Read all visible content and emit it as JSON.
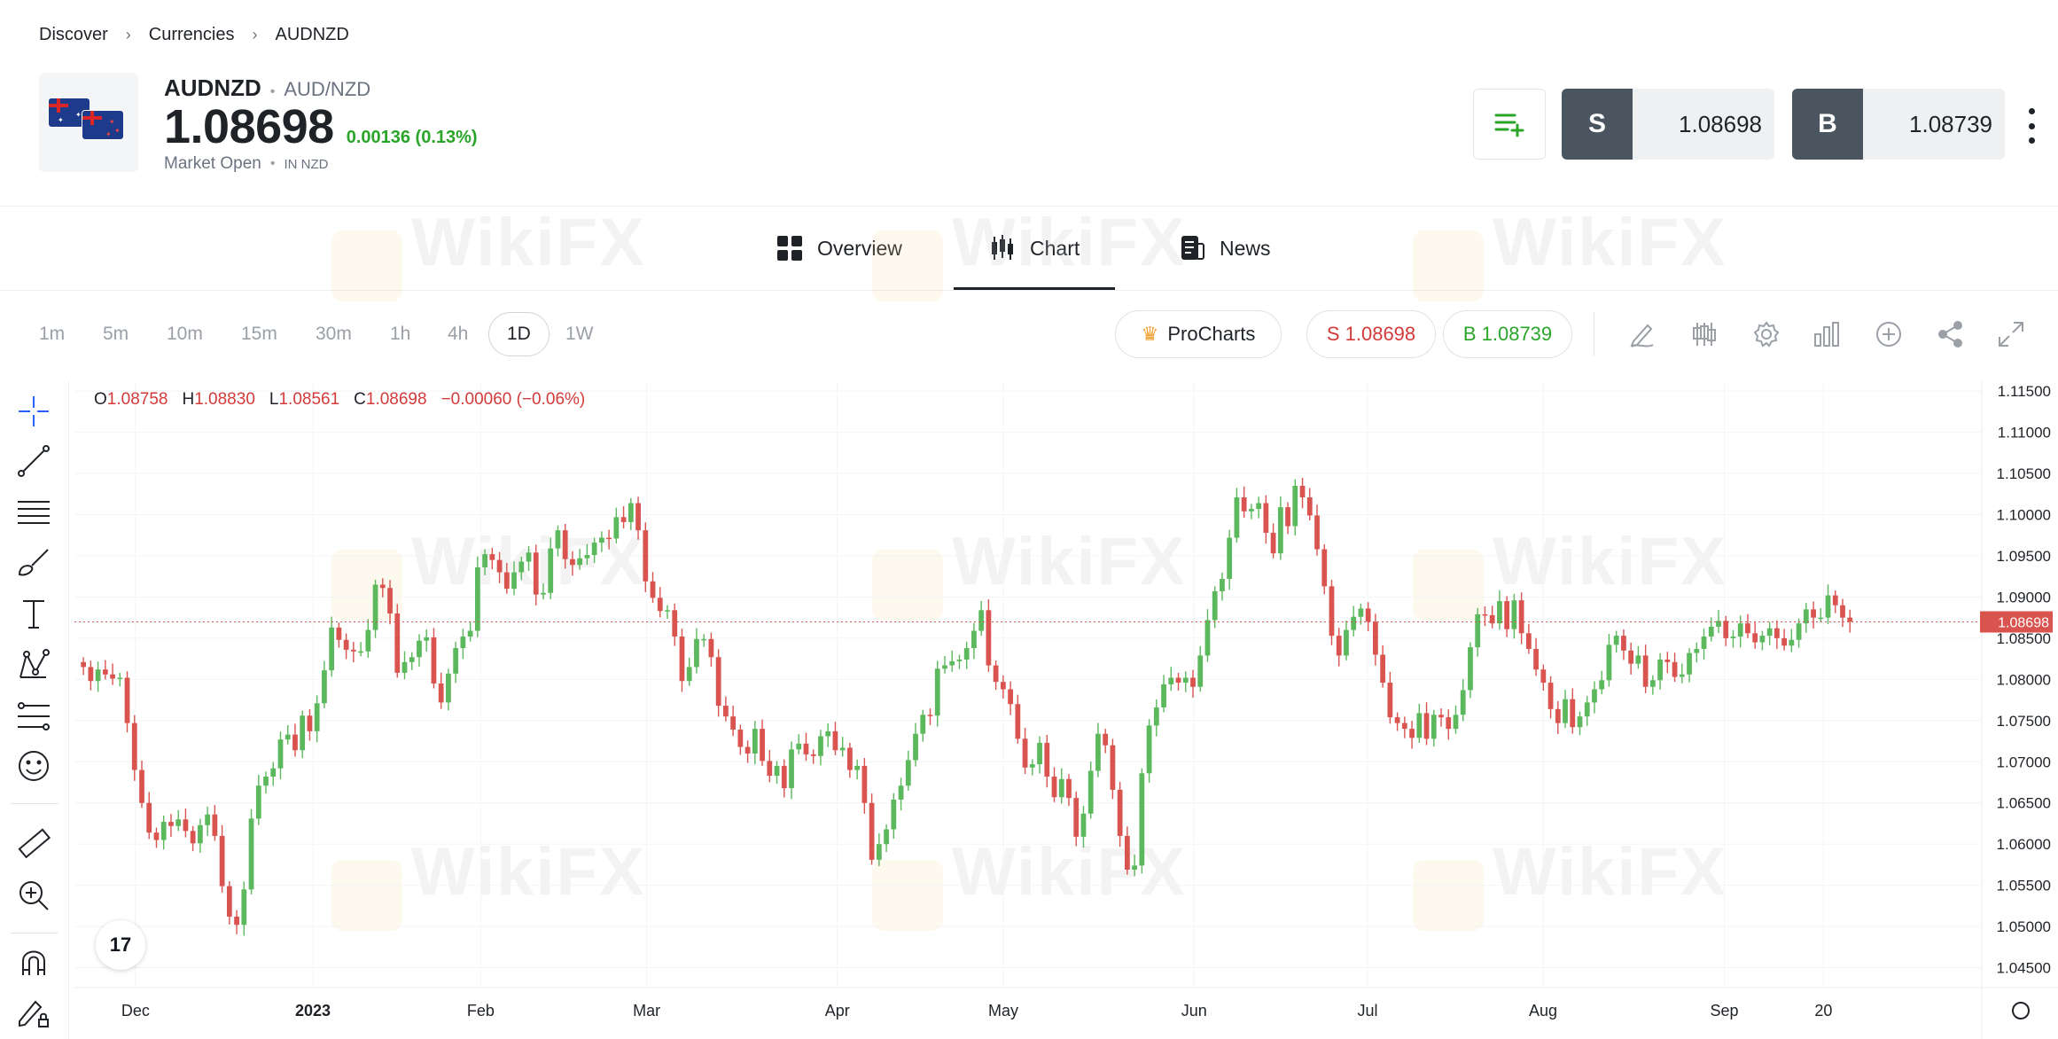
{
  "breadcrumb": [
    "Discover",
    "Currencies",
    "AUDNZD"
  ],
  "instrument": {
    "symbol": "AUDNZD",
    "pair": "AUD/NZD",
    "price": "1.08698",
    "change": "0.00136 (0.13%)",
    "status": "Market Open",
    "currency": "IN NZD"
  },
  "trade": {
    "sell_label": "S",
    "sell_price": "1.08698",
    "buy_label": "B",
    "buy_price": "1.08739"
  },
  "tabs": [
    {
      "label": "Overview",
      "icon": "grid-icon",
      "active": false
    },
    {
      "label": "Chart",
      "icon": "candles-icon",
      "active": true
    },
    {
      "label": "News",
      "icon": "news-icon",
      "active": false
    }
  ],
  "timeframes": [
    "1m",
    "5m",
    "10m",
    "15m",
    "30m",
    "1h",
    "4h",
    "1D",
    "1W"
  ],
  "active_timeframe": "1D",
  "toolbar": {
    "prochart_label": "ProCharts",
    "sell_pill": "S 1.08698",
    "buy_pill": "B 1.08739",
    "icons": [
      "draw-icon",
      "indicators-icon",
      "settings-icon",
      "bars-icon",
      "plus-circle-icon",
      "share-icon",
      "expand-icon"
    ]
  },
  "left_tools": [
    "crosshair-icon",
    "trendline-icon",
    "horizontal-lines-icon",
    "brush-icon",
    "text-icon",
    "pattern-icon",
    "fib-icon",
    "emoji-icon",
    "ruler-icon",
    "zoom-in-icon",
    "magnet-icon",
    "lock-draw-icon"
  ],
  "ohlc": {
    "o_label": "O",
    "o": "1.08758",
    "h_label": "H",
    "h": "1.08830",
    "l_label": "L",
    "l": "1.08561",
    "c_label": "C",
    "c": "1.08698",
    "chg": "−0.00060 (−0.06%)"
  },
  "tv_logo": "17",
  "watermark_text": "WikiFX",
  "colors": {
    "up": "#5cb85c",
    "down": "#d9534f",
    "accent_green": "#2aa52a",
    "accent_red": "#d33a3a",
    "button_dark": "#4a5560"
  },
  "chart_data": {
    "type": "candlestick",
    "symbol": "AUDNZD",
    "timeframe": "1D",
    "x_labels": [
      "Dec",
      "2023",
      "Feb",
      "Mar",
      "Apr",
      "May",
      "Jun",
      "Jul",
      "Aug",
      "Sep",
      "20"
    ],
    "y_ticks": [
      "1.11500",
      "1.11000",
      "1.10500",
      "1.10000",
      "1.09500",
      "1.09000",
      "1.08500",
      "1.08000",
      "1.07500",
      "1.07000",
      "1.06500",
      "1.06000",
      "1.05500",
      "1.05000",
      "1.04500"
    ],
    "ylim": [
      1.0428,
      1.1162
    ],
    "last_price": "1.08698",
    "last_price_value": 1.08698,
    "closes": [
      1.0815,
      1.0798,
      1.0812,
      1.0806,
      1.0801,
      1.0802,
      1.0747,
      1.069,
      1.065,
      1.0614,
      1.0605,
      1.0627,
      1.0622,
      1.063,
      1.0616,
      1.0601,
      1.0623,
      1.0636,
      1.061,
      1.0549,
      1.0512,
      1.0502,
      1.0545,
      1.0631,
      1.0671,
      1.0682,
      1.0692,
      1.0727,
      1.0733,
      1.0714,
      1.0756,
      1.0737,
      1.0771,
      1.0811,
      1.0863,
      1.0848,
      1.0836,
      1.0834,
      1.0834,
      1.086,
      1.0915,
      1.0911,
      1.088,
      1.0808,
      1.0821,
      1.0827,
      1.0847,
      1.0851,
      1.0795,
      1.0772,
      1.0807,
      1.0838,
      1.0852,
      1.0859,
      1.0936,
      1.0952,
      1.0945,
      1.093,
      1.091,
      1.093,
      1.0943,
      1.0954,
      1.0903,
      1.0905,
      1.0959,
      1.0981,
      1.0946,
      1.0939,
      1.0947,
      1.0951,
      1.0966,
      1.0972,
      1.0971,
      1.0997,
      1.0991,
      1.1014,
      1.0981,
      1.0919,
      1.0899,
      1.0883,
      1.0884,
      1.0852,
      1.0798,
      1.0815,
      1.0849,
      1.0849,
      1.0827,
      1.0768,
      1.0755,
      1.0739,
      1.0718,
      1.071,
      1.074,
      1.0701,
      1.0683,
      1.0695,
      1.0668,
      1.0715,
      1.0722,
      1.0709,
      1.0707,
      1.0731,
      1.0737,
      1.0714,
      1.0717,
      1.069,
      1.0695,
      1.065,
      1.0581,
      1.06,
      1.0618,
      1.0654,
      1.0671,
      1.0702,
      1.0734,
      1.0757,
      1.0756,
      1.0813,
      1.0817,
      1.0822,
      1.0824,
      1.0838,
      1.0859,
      1.0884,
      1.0817,
      1.0797,
      1.0788,
      1.077,
      1.0728,
      1.0693,
      1.0697,
      1.0723,
      1.0682,
      1.0657,
      1.0679,
      1.0656,
      1.0609,
      1.0637,
      1.0689,
      1.0734,
      1.072,
      1.0666,
      1.061,
      1.0569,
      1.0574,
      1.0686,
      1.0744,
      1.0766,
      1.0794,
      1.0802,
      1.0796,
      1.0802,
      1.0791,
      1.0829,
      1.0872,
      1.0907,
      1.0922,
      1.0972,
      1.1021,
      1.1004,
      1.1007,
      1.1014,
      1.0978,
      1.0953,
      1.1009,
      1.0986,
      1.1035,
      1.1021,
      1.0999,
      1.0958,
      1.0913,
      1.0853,
      1.0829,
      1.086,
      1.0876,
      1.0886,
      1.087,
      1.083,
      1.0796,
      1.0754,
      1.0747,
      1.074,
      1.0729,
      1.0759,
      1.0728,
      1.0757,
      1.0754,
      1.074,
      1.0757,
      1.0787,
      1.0839,
      1.0879,
      1.0878,
      1.0868,
      1.0895,
      1.0861,
      1.0896,
      1.0856,
      1.0837,
      1.0812,
      1.0796,
      1.0764,
      1.0747,
      1.0776,
      1.0742,
      1.0755,
      1.0772,
      1.0788,
      1.0799,
      1.0842,
      1.0853,
      1.0835,
      1.0819,
      1.0829,
      1.0791,
      1.0799,
      1.0824,
      1.0821,
      1.0803,
      1.0806,
      1.0832,
      1.0837,
      1.0852,
      1.0864,
      1.0871,
      1.085,
      1.0852,
      1.0868,
      1.0856,
      1.0845,
      1.0853,
      1.0862,
      1.085,
      1.0841,
      1.0848,
      1.0868,
      1.0885,
      1.0875,
      1.0875,
      1.0902,
      1.089,
      1.0875,
      1.087
    ]
  }
}
